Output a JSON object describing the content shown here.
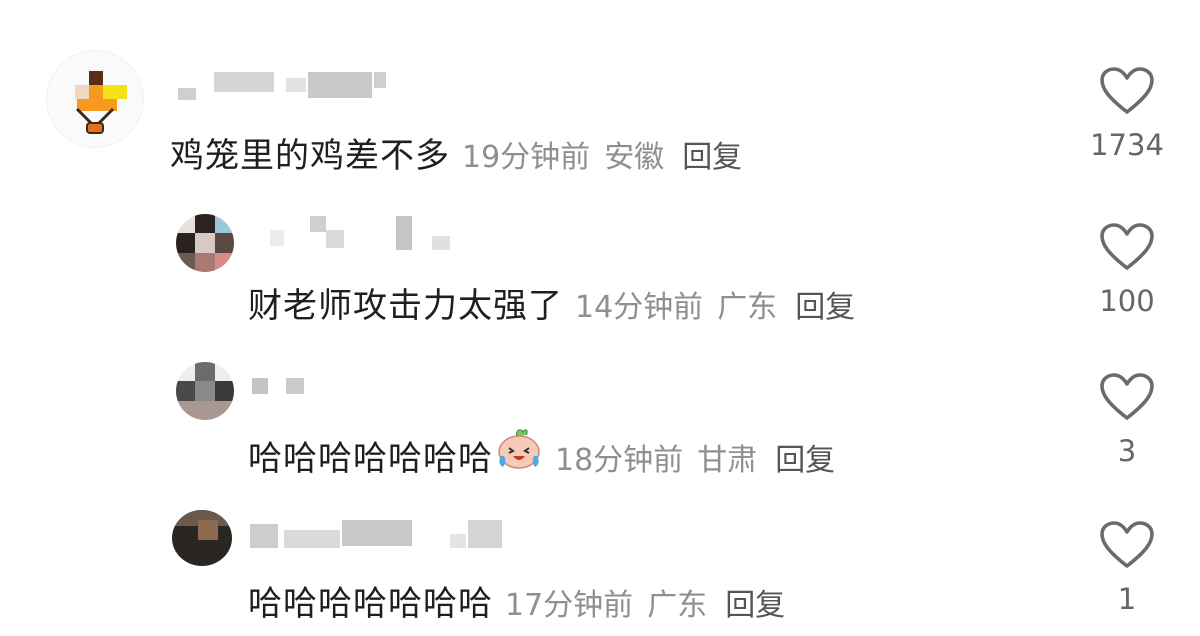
{
  "comments": [
    {
      "text": "鸡笼里的鸡差不多",
      "time": "19分钟前",
      "location": "安徽",
      "reply": "回复",
      "likes": "1734",
      "level": "top",
      "avatar_icon": "hot-air-balloon-icon"
    },
    {
      "text": "财老师攻击力太强了",
      "time": "14分钟前",
      "location": "广东",
      "reply": "回复",
      "likes": "100",
      "level": "reply"
    },
    {
      "text": "哈哈哈哈哈哈哈",
      "emoji": "laughing-crying-face-icon",
      "time": "18分钟前",
      "location": "甘肃",
      "reply": "回复",
      "likes": "3",
      "level": "reply"
    },
    {
      "text": "哈哈哈哈哈哈哈",
      "time": "17分钟前",
      "location": "广东",
      "reply": "回复",
      "likes": "1",
      "level": "reply"
    }
  ],
  "colors": {
    "text": "#1f1f1f",
    "meta": "#8f8f8f",
    "reply": "#555555",
    "heart_outline": "#6b6b6b",
    "balloon_orange": "#f59a1e",
    "balloon_yellow": "#f5e31a"
  }
}
